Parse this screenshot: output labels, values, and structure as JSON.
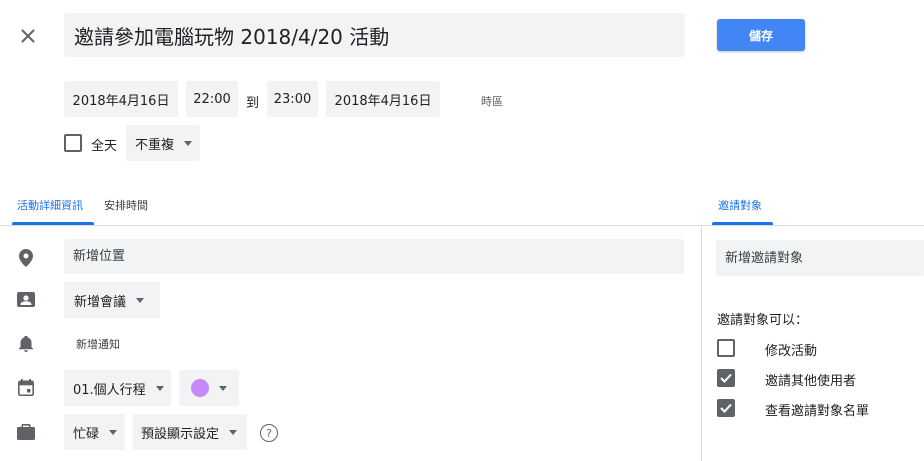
{
  "header": {
    "title_value": "邀請參加電腦玩物 2018/4/20 活動",
    "save_label": "儲存"
  },
  "datetime": {
    "start_date": "2018年4月16日",
    "start_time": "22:00",
    "to_label": "到",
    "end_time": "23:00",
    "end_date": "2018年4月16日",
    "timezone_label": "時區",
    "all_day_label": "全天",
    "all_day_checked": false,
    "repeat_value": "不重複"
  },
  "tabs": {
    "details": "活動詳細資訊",
    "find_time": "安排時間",
    "guests": "邀請對象"
  },
  "details": {
    "location_placeholder": "新增位置",
    "conference_label": "新增會議",
    "notification_label": "新增通知",
    "calendar_value": "01.個人行程",
    "calendar_color": "#c58af9",
    "availability_value": "忙碌",
    "visibility_value": "預設顯示設定",
    "help_symbol": "?"
  },
  "guests": {
    "add_placeholder": "新增邀請對象",
    "permissions_heading": "邀請對象可以：",
    "permissions": [
      {
        "label": "修改活動",
        "checked": false
      },
      {
        "label": "邀請其他使用者",
        "checked": true
      },
      {
        "label": "查看邀請對象名單",
        "checked": true
      }
    ]
  },
  "colors": {
    "accent": "#1a73e8",
    "save_button": "#4285f4",
    "field_bg": "#f1f3f4",
    "icon": "#5f6368"
  }
}
